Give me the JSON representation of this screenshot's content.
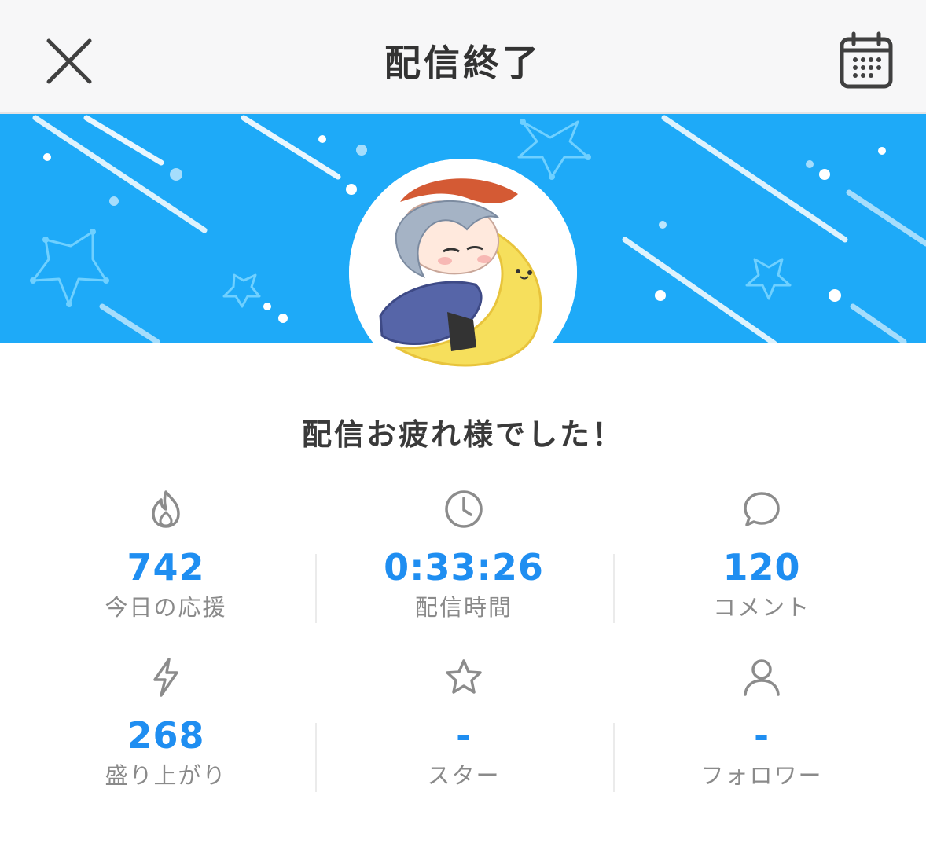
{
  "header": {
    "title": "配信終了",
    "close_icon": "close-icon",
    "calendar_icon": "calendar-icon"
  },
  "banner": {
    "background_color": "#1eaaf8",
    "decoration": "stars-and-streaks"
  },
  "avatar": {
    "description_icon": "avatar-character-on-moon"
  },
  "message": "配信お疲れ様でした！",
  "stats": [
    {
      "icon": "flame-icon",
      "value": "742",
      "label": "今日の応援"
    },
    {
      "icon": "clock-icon",
      "value": "0:33:26",
      "label": "配信時間"
    },
    {
      "icon": "comment-bubble-icon",
      "value": "120",
      "label": "コメント"
    },
    {
      "icon": "lightning-icon",
      "value": "268",
      "label": "盛り上がり"
    },
    {
      "icon": "star-icon",
      "value": "-",
      "label": "スター"
    },
    {
      "icon": "person-icon",
      "value": "-",
      "label": "フォロワー"
    }
  ],
  "colors": {
    "accent": "#1f8ef1",
    "label_gray": "#8a8a8a",
    "icon_gray": "#8c8c8c",
    "title_dark": "#333333"
  }
}
